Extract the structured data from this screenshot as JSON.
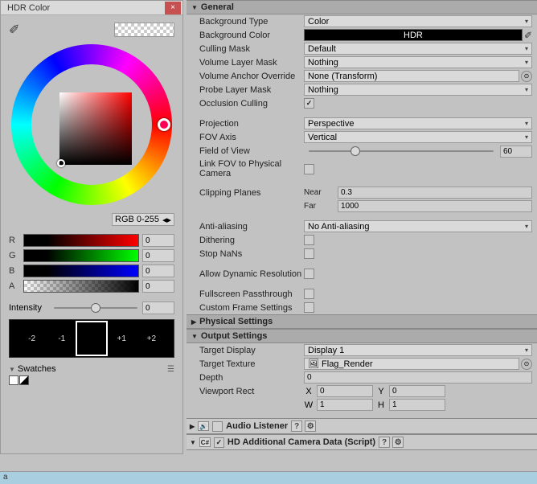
{
  "hdr": {
    "title": "HDR Color",
    "mode": "RGB 0-255",
    "channels": {
      "r": "0",
      "g": "0",
      "b": "0",
      "a": "0"
    },
    "intensityLabel": "Intensity",
    "intensityVal": "0",
    "presets": [
      "-2",
      "-1",
      "",
      "+1",
      "+2"
    ],
    "swatchesLabel": "Swatches"
  },
  "general": {
    "header": "General",
    "rows": {
      "bgType": {
        "label": "Background Type",
        "value": "Color"
      },
      "bgColor": {
        "label": "Background Color",
        "value": "HDR"
      },
      "cullingMask": {
        "label": "Culling Mask",
        "value": "Default"
      },
      "volLayerMask": {
        "label": "Volume Layer Mask",
        "value": "Nothing"
      },
      "volAnchor": {
        "label": "Volume Anchor Override",
        "value": "None (Transform)"
      },
      "probeLayer": {
        "label": "Probe Layer Mask",
        "value": "Nothing"
      },
      "occlusion": {
        "label": "Occlusion Culling"
      },
      "projection": {
        "label": "Projection",
        "value": "Perspective"
      },
      "fovAxis": {
        "label": "FOV Axis",
        "value": "Vertical"
      },
      "fov": {
        "label": "Field of View",
        "value": "60"
      },
      "linkFov": {
        "label": "Link FOV to Physical Camera"
      },
      "clipPlanes": {
        "label": "Clipping Planes",
        "nearLabel": "Near",
        "nearVal": "0.3",
        "farLabel": "Far",
        "farVal": "1000"
      },
      "aa": {
        "label": "Anti-aliasing",
        "value": "No Anti-aliasing"
      },
      "dithering": {
        "label": "Dithering"
      },
      "stopNans": {
        "label": "Stop NaNs"
      },
      "allowDyn": {
        "label": "Allow Dynamic Resolution"
      },
      "fullscreen": {
        "label": "Fullscreen Passthrough"
      },
      "custom": {
        "label": "Custom Frame Settings"
      }
    }
  },
  "physical": {
    "header": "Physical Settings"
  },
  "output": {
    "header": "Output Settings",
    "targetDisplay": {
      "label": "Target Display",
      "value": "Display 1"
    },
    "targetTexture": {
      "label": "Target Texture",
      "value": "Flag_Render"
    },
    "depth": {
      "label": "Depth",
      "value": "0"
    },
    "viewport": {
      "label": "Viewport Rect",
      "x": "0",
      "y": "0",
      "w": "1",
      "h": "1",
      "xl": "X",
      "yl": "Y",
      "wl": "W",
      "hl": "H"
    }
  },
  "components": {
    "audio": "Audio Listener",
    "hdcam": "HD Additional Camera Data (Script)"
  },
  "footer": "a"
}
